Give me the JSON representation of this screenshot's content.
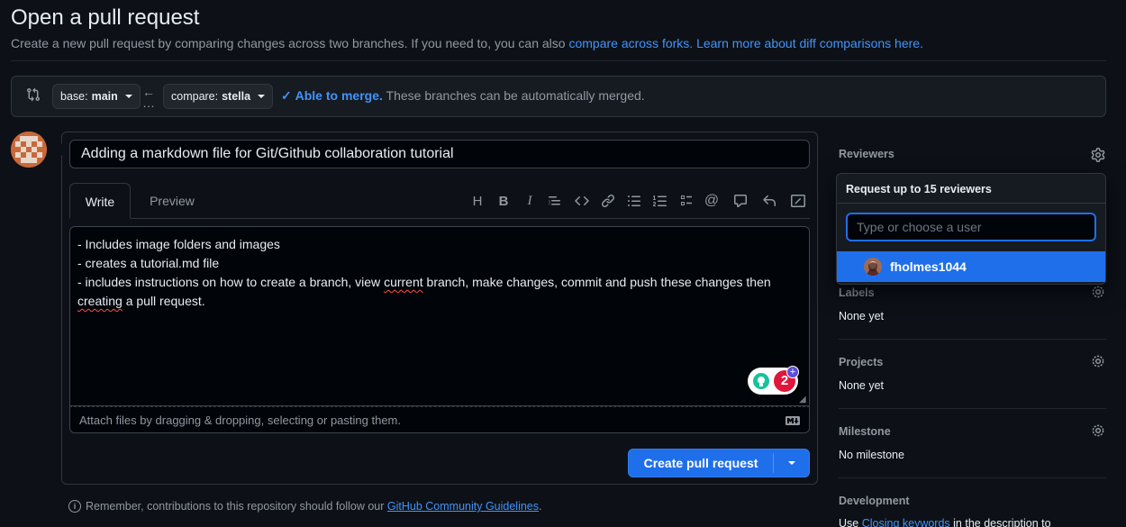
{
  "header": {
    "title": "Open a pull request",
    "subtitle": "Create a new pull request by comparing changes across two branches. If you need to, you can also ",
    "link_forks": "compare across forks.",
    "link_learn": "Learn more about diff comparisons here."
  },
  "range": {
    "base_prefix": "base:",
    "base_branch": "main",
    "compare_prefix": "compare:",
    "compare_branch": "stella",
    "merge_status": "Able to merge.",
    "merge_message": "These branches can be automatically merged."
  },
  "composer": {
    "title_value": "Adding a markdown file for Git/Github collaboration tutorial",
    "tab_write": "Write",
    "tab_preview": "Preview",
    "body_lines": [
      "- Includes image folders and images",
      "- creates a tutorial.md file",
      "- includes instructions on how to create a branch, view ",
      "current",
      " branch, make changes, commit and push these changes then",
      "creating",
      " a pull request."
    ],
    "attach_hint": "Attach files by dragging & dropping, selecting or pasting them.",
    "grammar_count": "2",
    "create_label": "Create pull request"
  },
  "footer": {
    "remember_text": "Remember, contributions to this repository should follow our ",
    "guidelines_link": "GitHub Community Guidelines",
    "period": "."
  },
  "sidebar": {
    "reviewers": {
      "label": "Reviewers"
    },
    "labels": {
      "label": "Labels",
      "value": "None yet"
    },
    "projects": {
      "label": "Projects",
      "value": "None yet"
    },
    "milestone": {
      "label": "Milestone",
      "value": "No milestone"
    },
    "development": {
      "label": "Development",
      "value_prefix": "Use ",
      "value_link": "Closing keywords",
      "value_suffix": " in the description to"
    }
  },
  "reviewer_popup": {
    "heading": "Request up to 15 reviewers",
    "placeholder": "Type or choose a user",
    "suggestion": "fholmes1044"
  },
  "colors": {
    "accent": "#1f6feb",
    "link": "#4493f8",
    "background": "#0d1117"
  }
}
